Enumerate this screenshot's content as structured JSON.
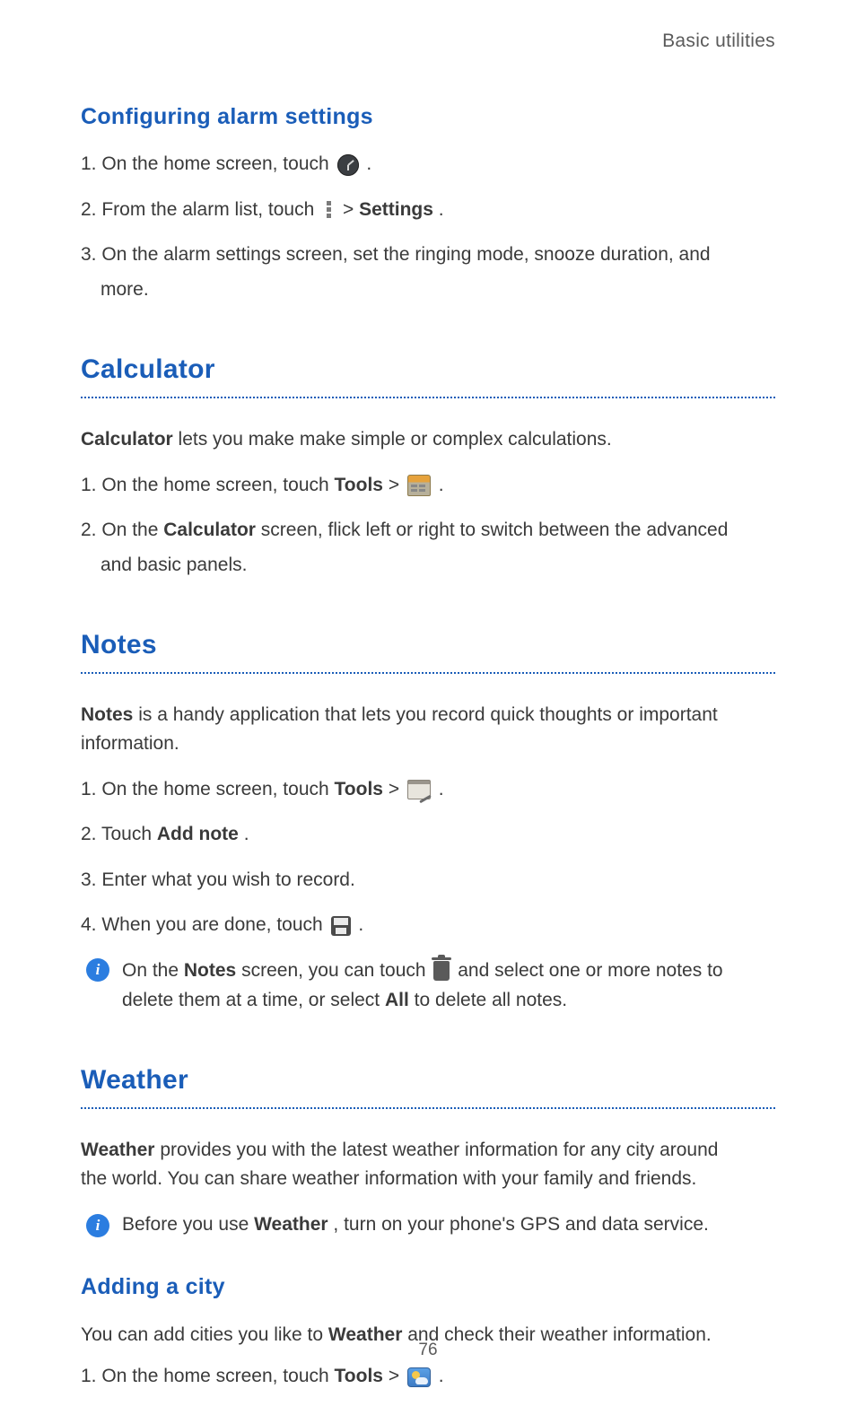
{
  "header": {
    "crumb": "Basic utilities"
  },
  "section_config_alarm": {
    "title": "Configuring  alarm  settings",
    "steps": [
      {
        "num": "1.",
        "a": "On the home screen, touch ",
        "b": " ."
      },
      {
        "num": "2.",
        "a": "From the alarm list, touch ",
        "gt": " > ",
        "bold": "Settings",
        "b": "."
      },
      {
        "num": "3.",
        "a": "On the alarm settings screen, set the ringing mode, snooze duration, and",
        "cont": "more."
      }
    ]
  },
  "section_calculator": {
    "title": "Calculator",
    "intro_a": "Calculator",
    "intro_b": " lets you make make simple or complex calculations.",
    "steps": [
      {
        "num": "1.",
        "a": "On the home screen, touch ",
        "bold": "Tools",
        "gt": " > ",
        "b": " ."
      },
      {
        "num": "2.",
        "a": "On the ",
        "bold": "Calculator",
        "b": " screen, flick left or right to switch between the advanced",
        "cont": "and basic panels."
      }
    ]
  },
  "section_notes": {
    "title": "Notes",
    "intro_a": "Notes",
    "intro_b": " is a handy application that lets you record quick thoughts or important",
    "intro_c": "information.",
    "steps": [
      {
        "num": "1.",
        "a": "On the home screen, touch ",
        "bold": "Tools",
        "gt": " > ",
        "b": " ."
      },
      {
        "num": "2.",
        "a": "Touch ",
        "bold": "Add note",
        "b": "."
      },
      {
        "num": "3.",
        "a": "Enter what you wish to record."
      },
      {
        "num": "4.",
        "a": "When you are done, touch ",
        "b": " ."
      }
    ],
    "info_a": "On the ",
    "info_bold1": "Notes",
    "info_b": " screen, you can touch ",
    "info_c": " and select one or more notes to",
    "info_d": "delete them at a time, or select ",
    "info_bold2": "All",
    "info_e": " to delete all notes."
  },
  "section_weather": {
    "title": "Weather",
    "intro_a": "Weather",
    "intro_b": " provides you with the latest weather information for any city around",
    "intro_c": "the world. You can share weather information with your family and friends.",
    "info_a": "Before you use ",
    "info_bold": "Weather",
    "info_b": ", turn on your phone's GPS and data service.",
    "sub_title": "Adding  a  city",
    "sub_intro_a": "You can add cities you like to ",
    "sub_intro_bold": "Weather",
    "sub_intro_b": " and check their weather information.",
    "steps": [
      {
        "num": "1.",
        "a": "On the home screen, touch ",
        "bold": "Tools",
        "gt": " > ",
        "b": " ."
      }
    ]
  },
  "page_number": "76",
  "info_glyph": "i"
}
